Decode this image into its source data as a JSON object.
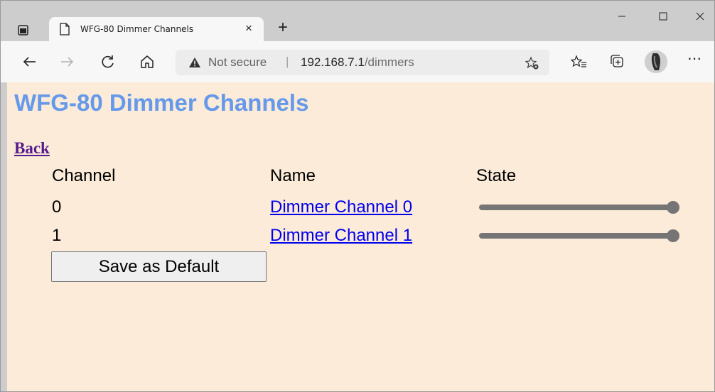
{
  "browser": {
    "tab": {
      "title": "WFG-80 Dimmer Channels",
      "favicon": "page-icon"
    },
    "window_controls": {
      "minimize": "—",
      "maximize": "☐",
      "close": "✕"
    },
    "address_bar": {
      "security_label": "Not secure",
      "separator": "|",
      "host": "192.168.7.1",
      "path": "/dimmers"
    }
  },
  "page": {
    "title": "WFG-80 Dimmer Channels",
    "back_link": "Back",
    "table": {
      "headers": [
        "Channel",
        "Name",
        "State"
      ],
      "rows": [
        {
          "channel": "0",
          "name": "Dimmer Channel 0",
          "state": 1.0
        },
        {
          "channel": "1",
          "name": "Dimmer Channel 1",
          "state": 1.0
        }
      ]
    },
    "save_button": "Save as Default"
  },
  "colors": {
    "page_background": "#fbebd8",
    "title": "#6699ea",
    "link": "#0000ee",
    "visited_link": "#551a8b",
    "slider": "#757575"
  }
}
